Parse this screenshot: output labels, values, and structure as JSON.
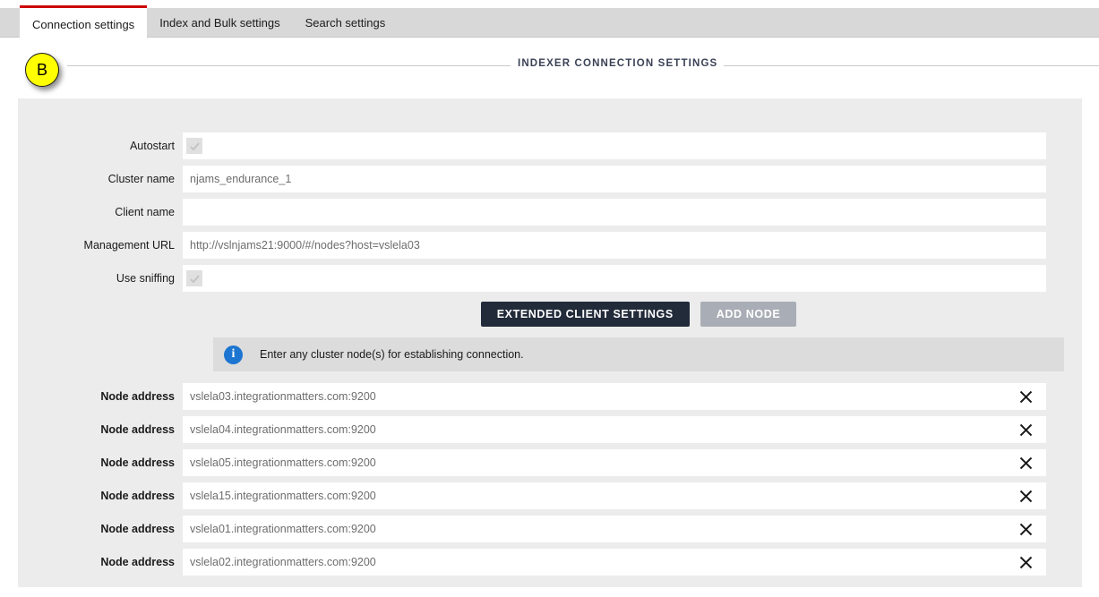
{
  "tabs": [
    {
      "label": "Connection settings",
      "active": true
    },
    {
      "label": "Index and Bulk settings",
      "active": false
    },
    {
      "label": "Search settings",
      "active": false
    }
  ],
  "badge": {
    "letter": "B"
  },
  "section": {
    "title": "INDEXER CONNECTION SETTINGS"
  },
  "form": {
    "fields": [
      {
        "label": "Autostart",
        "type": "checkbox",
        "checked": true,
        "value": ""
      },
      {
        "label": "Cluster name",
        "type": "text",
        "value": "njams_endurance_1"
      },
      {
        "label": "Client name",
        "type": "text",
        "value": ""
      },
      {
        "label": "Management URL",
        "type": "text",
        "value": "http://vslnjams21:9000/#/nodes?host=vslela03"
      },
      {
        "label": "Use sniffing",
        "type": "checkbox",
        "checked": true,
        "value": ""
      }
    ]
  },
  "buttons": {
    "extended_client_settings": "EXTENDED CLIENT SETTINGS",
    "add_node": "ADD NODE"
  },
  "info": {
    "icon": "info-icon",
    "message": "Enter any cluster node(s) for establishing connection."
  },
  "nodes": {
    "label": "Node address",
    "items": [
      {
        "address": "vslela03.integrationmatters.com:9200"
      },
      {
        "address": "vslela04.integrationmatters.com:9200"
      },
      {
        "address": "vslela05.integrationmatters.com:9200"
      },
      {
        "address": "vslela15.integrationmatters.com:9200"
      },
      {
        "address": "vslela01.integrationmatters.com:9200"
      },
      {
        "address": "vslela02.integrationmatters.com:9200"
      }
    ]
  },
  "colors": {
    "active_tab_accent": "#cc0000",
    "badge": "#ffff00",
    "primary_button": "#222b3a",
    "disabled_button": "#a9adb5",
    "info_icon": "#1c75d0",
    "panel_bg": "#ececec"
  }
}
